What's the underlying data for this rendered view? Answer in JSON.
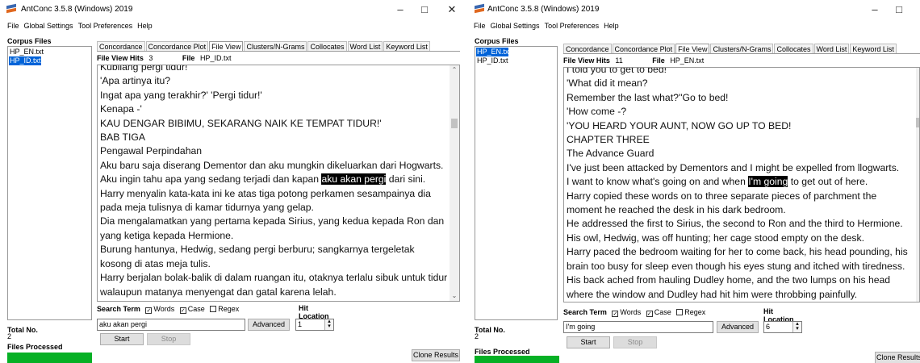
{
  "left": {
    "title": "AntConc 3.5.8 (Windows) 2019",
    "menu": [
      "File",
      "Global Settings",
      "Tool Preferences",
      "Help"
    ],
    "corpus_title": "Corpus Files",
    "corpus_files": [
      "HP_EN.txt",
      "HP_ID.txt"
    ],
    "tabs": [
      "Concordance",
      "Concordance Plot",
      "File View",
      "Clusters/N-Grams",
      "Collocates",
      "Word List",
      "Keyword List"
    ],
    "hits_label": "File View Hits",
    "hits_value": "3",
    "file_label": "File",
    "file_value": "HP_ID.txt",
    "lines": {
      "l0": "Kubilang pergi tidur!",
      "l1": "'Apa artinya itu?",
      "l2": "Ingat apa yang terakhir?' 'Pergi tidur!'",
      "l3": "Kenapa -'",
      "l4": "KAU DENGAR BIBIMU, SEKARANG NAIK KE TEMPAT TIDUR!'",
      "l5": "BAB TIGA",
      "l6": "Pengawal Perpindahan",
      "l7": "Aku baru saja diserang Dementor dan aku mungkin dikeluarkan dari Hogwarts.",
      "l8a": "Aku ingin tahu apa yang sedang terjadi dan kapan ",
      "l8h": "aku akan pergi",
      "l8b": " dari sini.",
      "l9": "Harry menyalin kata-kata ini ke atas tiga potong perkamen sesampainya dia pada meja tulisnya di kamar tidurnya yang gelap.",
      "l10": "Dia mengalamatkan yang pertama kepada Sirius, yang kedua kepada Ron dan yang ketiga kepada Hermione.",
      "l11": "Burung hantunya, Hedwig, sedang pergi berburu; sangkarnya tergeletak kosong di atas meja tulis.",
      "l12": "Harry berjalan bolak-balik di dalam ruangan itu, otaknya terlalu sibuk untuk tidur walaupun matanya menyengat dan gatal karena lelah."
    },
    "search_term_label": "Search Term",
    "opt_words": "Words",
    "opt_case": "Case",
    "opt_regex": "Regex",
    "hit_location_label": "Hit Location",
    "search_value": "aku akan pergi",
    "advanced": "Advanced",
    "hit_location_value": "1",
    "start": "Start",
    "stop": "Stop",
    "clone": "Clone Results",
    "total_no_label": "Total No.",
    "total_no_value": "2",
    "files_processed_label": "Files Processed",
    "progress": 1.0
  },
  "right": {
    "title": "AntConc 3.5.8 (Windows) 2019",
    "menu": [
      "File",
      "Global Settings",
      "Tool Preferences",
      "Help"
    ],
    "corpus_title": "Corpus Files",
    "corpus_files": [
      "HP_EN.txt",
      "HP_ID.txt"
    ],
    "tabs": [
      "Concordance",
      "Concordance Plot",
      "File View",
      "Clusters/N-Grams",
      "Collocates",
      "Word List",
      "Keyword List"
    ],
    "hits_label": "File View Hits",
    "hits_value": "11",
    "file_label": "File",
    "file_value": "HP_EN.txt",
    "lines": {
      "l0": "I told you to get to bed!",
      "l1": "'What did it mean?",
      "l2": "Remember the last what?''Go to bed!",
      "l3": "'How come -?",
      "l4": "'YOU HEARD YOUR AUNT, NOW GO UP TO BED!",
      "l5": "CHAPTER THREE",
      "l6": "The Advance Guard",
      "l7": "I've just been attacked by Dementors and I might be expelled from llogwarts.",
      "l8a": "I want to know what's going on and when ",
      "l8h": "I'm going",
      "l8b": " to get out of here.",
      "l9": "Harry copied these words on to three separate pieces of parchment the moment he reached the desk in his dark bedroom.",
      "l10": "He addressed the first to Sirius, the second to Ron and the third to Hermione.",
      "l11": "His owl, Hedwig, was off hunting; her cage stood empty on the desk.",
      "l12": "Harry paced the bedroom waiting for her to come back, his head pounding, his brain too busy for sleep even though his eyes stung and itched with tiredness.",
      "l13": "His back ached from hauling Dudley home, and the two lumps on his head where the window and Dudley had hit him were throbbing painfully."
    },
    "search_term_label": "Search Term",
    "opt_words": "Words",
    "opt_case": "Case",
    "opt_regex": "Regex",
    "hit_location_label": "Hit Location",
    "search_value": "I'm going",
    "advanced": "Advanced",
    "hit_location_value": "6",
    "start": "Start",
    "stop": "Stop",
    "clone": "Clone Results",
    "total_no_label": "Total No.",
    "total_no_value": "2",
    "files_processed_label": "Files Processed",
    "progress": 1.0
  },
  "icons": {
    "minimize": "minimize-icon",
    "maximize": "maximize-icon",
    "close": "close-icon",
    "scroll_up": "chevron-up-icon",
    "scroll_down": "chevron-down-icon"
  },
  "colors": {
    "highlight_bg": "#000000",
    "selection": "#0063d8",
    "progress": "#06b025"
  }
}
